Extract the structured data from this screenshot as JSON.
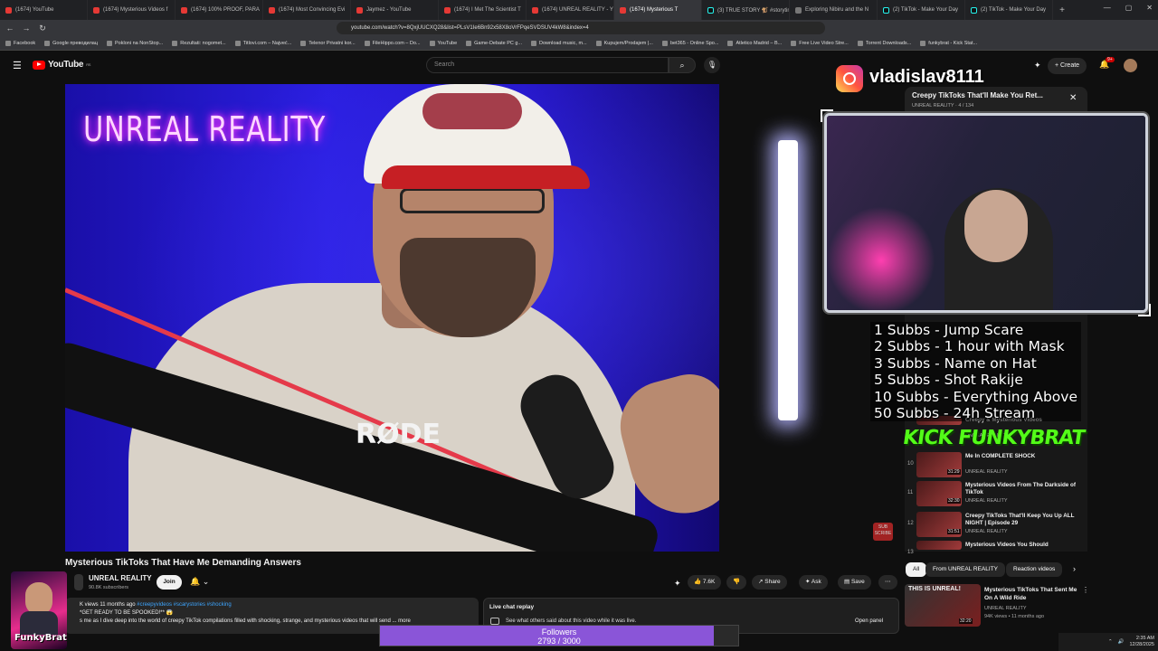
{
  "browser": {
    "tabs": [
      {
        "label": "(1674) YouTube",
        "type": "yt"
      },
      {
        "label": "(1674) Mysterious Videos f",
        "type": "yt"
      },
      {
        "label": "(1674) 100% PROOF, PARA",
        "type": "yt"
      },
      {
        "label": "(1674) Most Convincing Evi",
        "type": "yt"
      },
      {
        "label": "Jaymez - YouTube",
        "type": "yt"
      },
      {
        "label": "(1674) I Met The Scientist T",
        "type": "yt"
      },
      {
        "label": "(1674) UNREAL REALITY - Y",
        "type": "yt"
      },
      {
        "label": "(1674) Mysterious T",
        "type": "yt",
        "active": true
      },
      {
        "label": "(3) TRUE STORY 🐒 #storytim",
        "type": "tt"
      },
      {
        "label": "Exploring Nibiru and the N",
        "type": "gr"
      },
      {
        "label": "(2) TikTok - Make Your Day",
        "type": "tt"
      },
      {
        "label": "(2) TikTok - Make Your Day",
        "type": "tt"
      }
    ],
    "url": "youtube.com/watch?v=8QxjUUCXQ28&list=PLsV1Ie6Bn92x58X8oVrFPqeSVDSUV4kW8&index=4",
    "bookmarks": [
      "Facebook",
      "Google преводилац",
      "Pokloni na NonStop...",
      "Rezultati: nogomet...",
      "Titlovi.com – Najveć...",
      "Telenor Privatni kor...",
      "FileHippo.com – Do...",
      "YouTube",
      "Game-Debate PC g...",
      "Download music, m...",
      "Kupujem/Prodajem |...",
      "bet365 - Online Spo...",
      "Atletico Madrid – B...",
      "Free Live Video Stre...",
      "Torrent Downloads...",
      "funkybrat - Kick Stat..."
    ]
  },
  "yt": {
    "logo_text": "YouTube",
    "logo_region": "RS",
    "search_placeholder": "Search",
    "create_label": "Create",
    "notif_count": "9+"
  },
  "video": {
    "neon_text": "UNREAL REALITY",
    "mic_brand": "RØDE",
    "title": "Mysterious TikToks That Have Me Demanding Answers",
    "channel": "UNREAL REALITY",
    "subscribers": "90.8K subscribers",
    "join_label": "Join",
    "likes": "7.6K",
    "share_label": "Share",
    "ask_label": "Ask",
    "save_label": "Save",
    "desc_line1_views": "K views  11 months ago  ",
    "desc_line1_tags": "#creepyvideos #scarystories #shocking",
    "desc_line2": "*GET READY TO BE SPOOKED!** 😱",
    "desc_line3": "s me as I dive deep into the world of creepy TikTok compilations filled with shocking, strange, and mysterious videos that will send ... more",
    "sub_button": "SUB SCRIBE"
  },
  "chat": {
    "title": "Live chat replay",
    "subtitle": "See what others said about this video while it was live.",
    "open_panel": "Open panel"
  },
  "overlay": {
    "ig_name": "vladislav8111",
    "rules": [
      "1 Subbs - Jump Scare",
      "2 Subbs - 1 hour with Mask",
      "3 Subbs - Name on Hat",
      "5 Subbs - Shot Rakije",
      "10 Subbs - Everything Above",
      "50 Subbs - 24h Stream"
    ],
    "kick_logo": "KICK FUNKYBRAT",
    "streamer_name": "FunkyBrat",
    "followers_label": "Followers",
    "followers_count": "2793 / 3000",
    "followers_current": 2793,
    "followers_goal": 3000
  },
  "playlist": {
    "title": "Creepy TikToks That'll Make You Ret...",
    "channel_line": "UNREAL REALITY · 4 / 134",
    "items": [
      {
        "idx": "",
        "title": "Creepy & Mysterious Videos",
        "channel": "UNREAL REALITY",
        "dur": ""
      },
      {
        "idx": "10",
        "title": "Me In COMPLETE SHOCK",
        "channel": "UNREAL REALITY",
        "dur": "31:29"
      },
      {
        "idx": "11",
        "title": "Mysterious Videos From The Darkside of TikTok",
        "channel": "UNREAL REALITY",
        "dur": "32:30"
      },
      {
        "idx": "12",
        "title": "Creepy TikToks That'll Keep You Up ALL NIGHT | Episode 29",
        "channel": "UNREAL REALITY",
        "dur": "31:51"
      },
      {
        "idx": "13",
        "title": "Mysterious Videos You Should",
        "channel": "",
        "dur": ""
      }
    ]
  },
  "chips": [
    "All",
    "From UNREAL REALITY",
    "Reaction videos"
  ],
  "recommended": {
    "title": "THIS IS UNREAL! Mysterious TikToks That Sent Me On A Wild Ride",
    "title_short": "Mysterious TikToks That Sent Me On A Wild Ride",
    "channel": "UNREAL REALITY",
    "meta": "94K views • 11 months ago",
    "dur": "32:20"
  },
  "taskbar": {
    "time": "2:35 AM",
    "date": "12/28/2025"
  }
}
